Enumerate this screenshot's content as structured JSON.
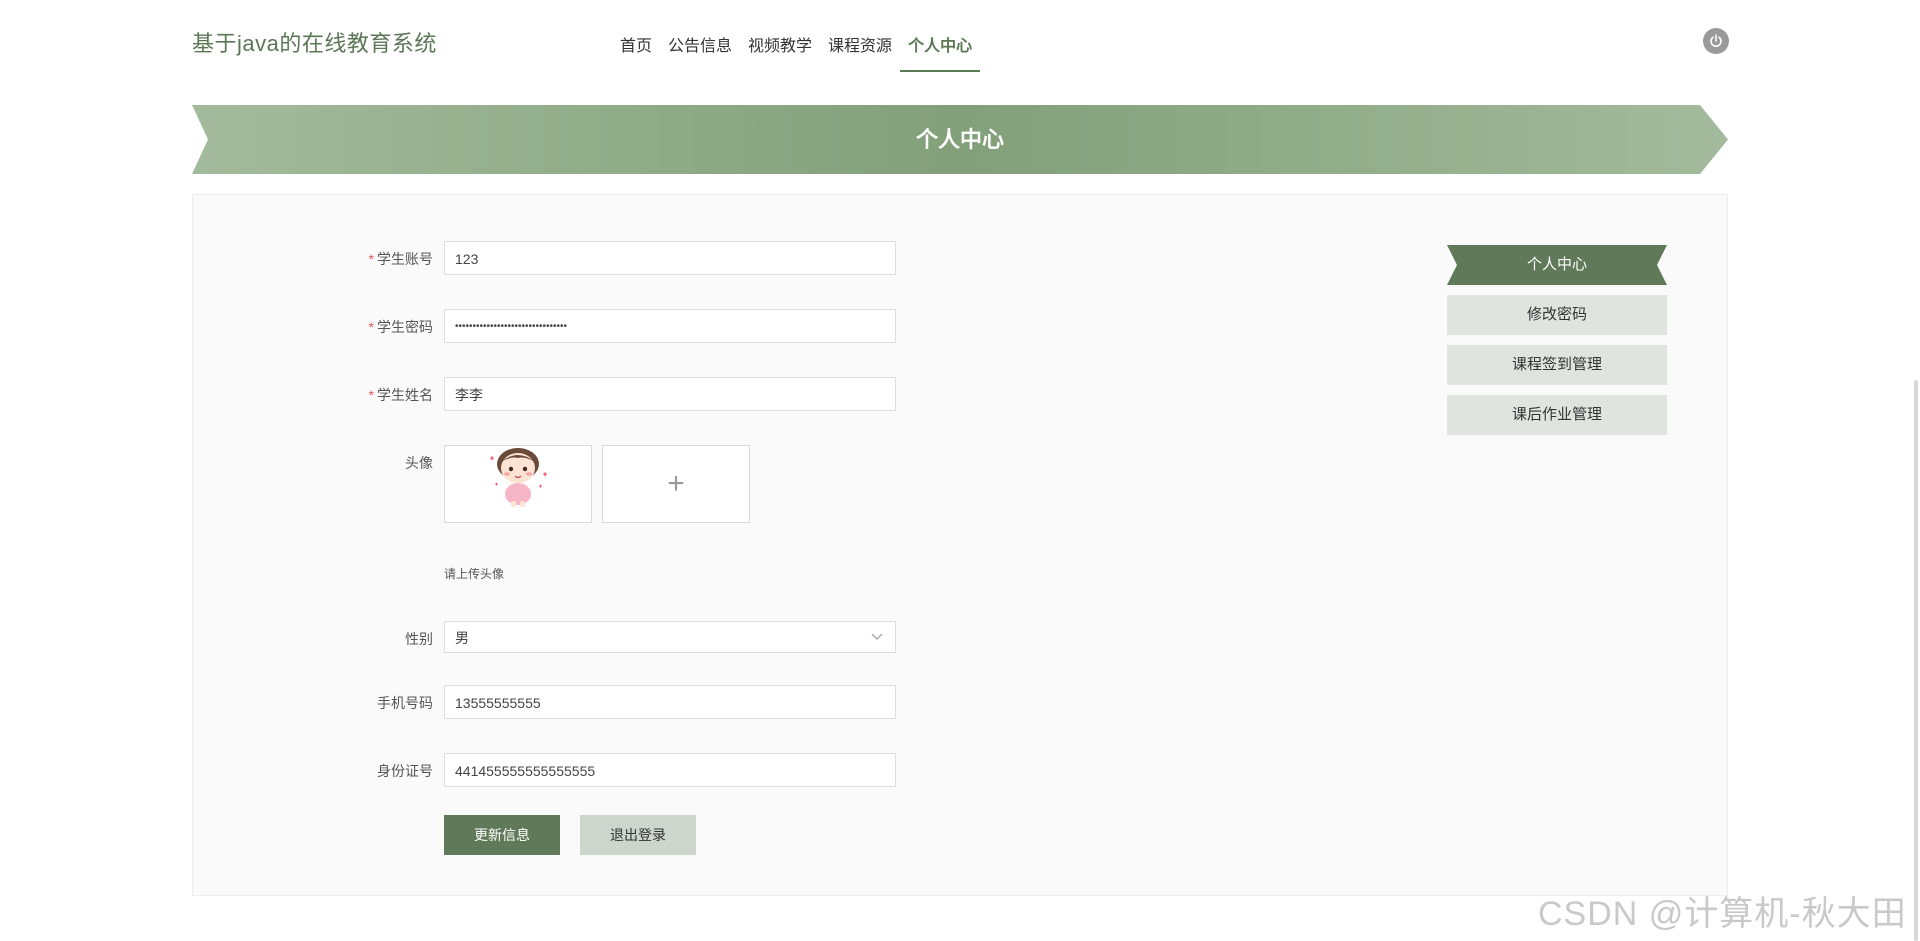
{
  "header": {
    "site_title": "基于java的在线教育系统",
    "nav": [
      {
        "label": "首页",
        "active": false
      },
      {
        "label": "公告信息",
        "active": false
      },
      {
        "label": "视频教学",
        "active": false
      },
      {
        "label": "课程资源",
        "active": false
      },
      {
        "label": "个人中心",
        "active": true
      }
    ],
    "power_icon": "power-icon"
  },
  "banner": {
    "title": "个人中心"
  },
  "form": {
    "account": {
      "label": "学生账号",
      "required": true,
      "value": "123"
    },
    "password": {
      "label": "学生密码",
      "required": true,
      "value": "••••••••••••••••••••••••••••••••"
    },
    "name": {
      "label": "学生姓名",
      "required": true,
      "value": "李李"
    },
    "avatar": {
      "label": "头像",
      "hint": "请上传头像",
      "add_symbol": "+"
    },
    "gender": {
      "label": "性别",
      "value": "男"
    },
    "phone": {
      "label": "手机号码",
      "value": "13555555555"
    },
    "id_card": {
      "label": "身份证号",
      "value": "441455555555555555"
    },
    "submit_label": "更新信息",
    "logout_label": "退出登录"
  },
  "side_menu": [
    {
      "label": "个人中心",
      "active": true
    },
    {
      "label": "修改密码",
      "active": false
    },
    {
      "label": "课程签到管理",
      "active": false
    },
    {
      "label": "课后作业管理",
      "active": false
    }
  ],
  "watermark": "CSDN @计算机-秋大田",
  "colors": {
    "accent": "#607a59",
    "banner_light": "#a3bb9c",
    "banner_dark": "#82a07a",
    "required": "#e05a5a"
  }
}
